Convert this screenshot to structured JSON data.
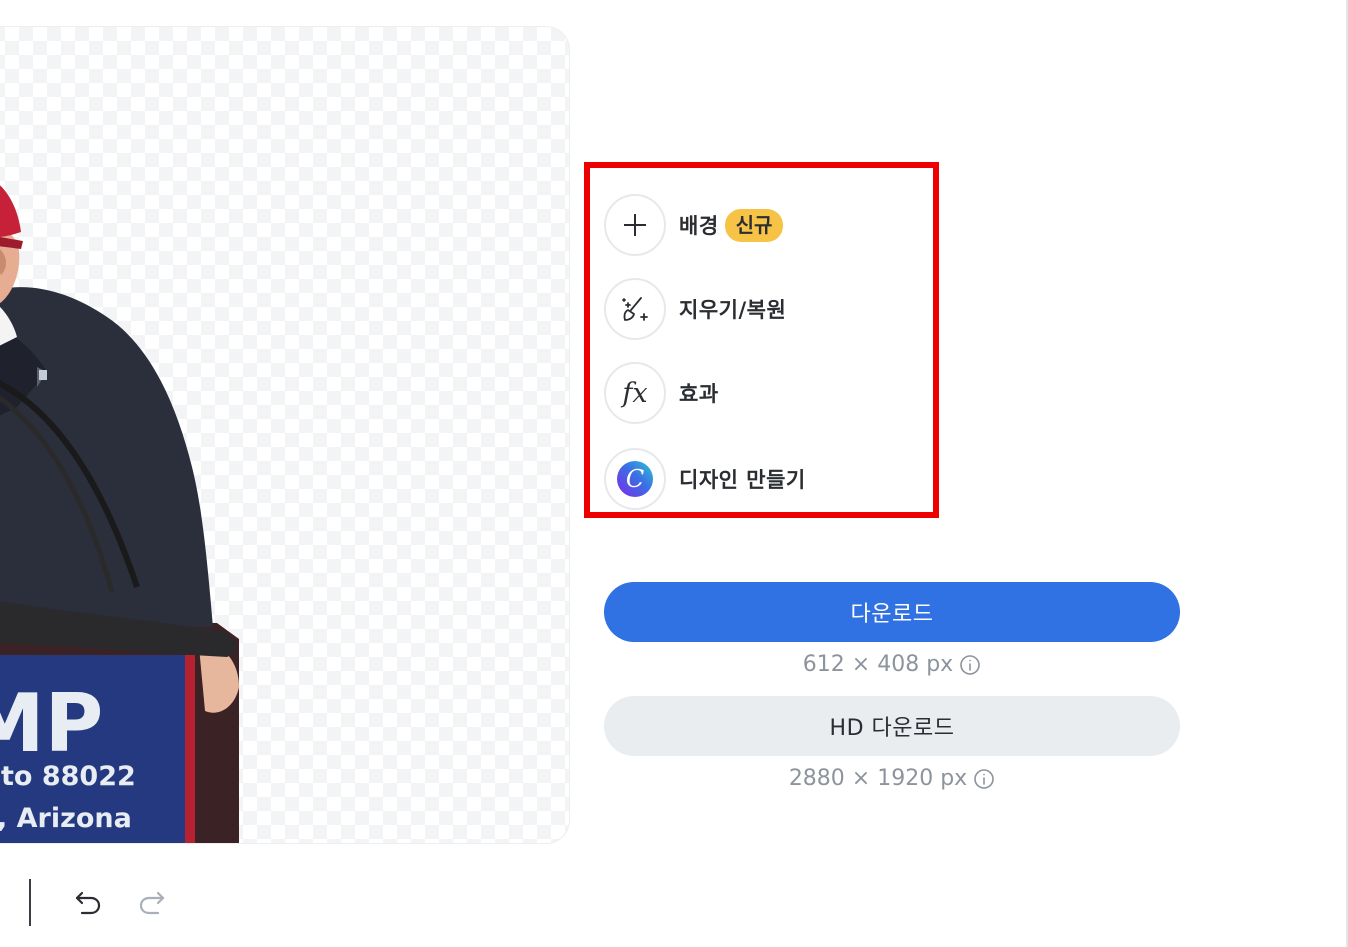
{
  "preview": {
    "sign_text_large": "MP",
    "sign_text_line2": "to 88022",
    "sign_text_line3": ", Arizona"
  },
  "tools": {
    "items": [
      {
        "label": "배경",
        "badge": "신규",
        "icon": "plus-icon"
      },
      {
        "label": "지우기/복원",
        "icon": "magic-brush-icon"
      },
      {
        "label": "효과",
        "icon": "fx-icon",
        "glyph": "fx"
      },
      {
        "label": "디자인 만들기",
        "icon": "canva-logo-icon",
        "glyph": "C"
      }
    ],
    "highlight_color": "#ee0000"
  },
  "download": {
    "label": "다운로드",
    "size": "612 × 408 px",
    "color": "#3071e3"
  },
  "hd_download": {
    "label": "HD 다운로드",
    "size": "2880 × 1920 px"
  },
  "toolbar": {
    "undo_icon": "undo-icon",
    "redo_icon": "redo-icon"
  }
}
